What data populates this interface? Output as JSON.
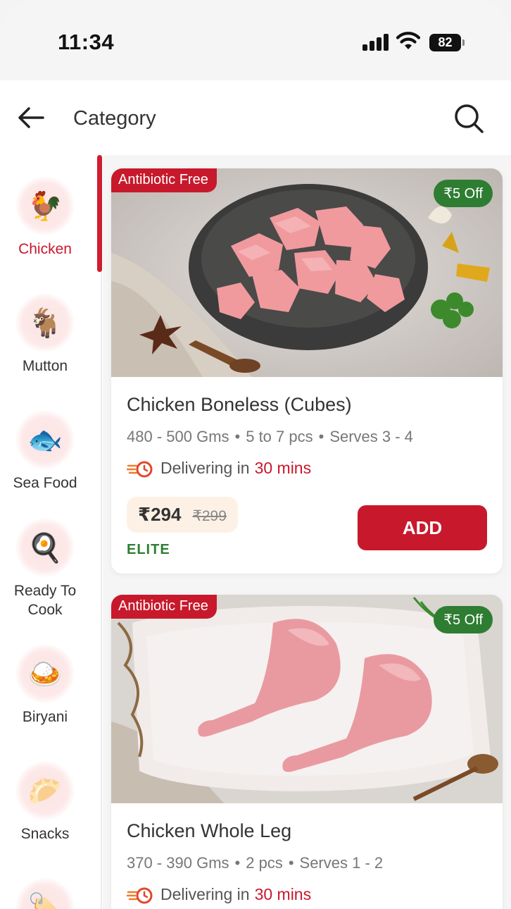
{
  "status_bar": {
    "time": "11:34",
    "battery": "82"
  },
  "header": {
    "title": "Category"
  },
  "categories": [
    {
      "label": "Chicken",
      "icon": "rooster-icon",
      "active": true
    },
    {
      "label": "Mutton",
      "icon": "goat-icon",
      "active": false
    },
    {
      "label": "Sea Food",
      "icon": "fish-icon",
      "active": false
    },
    {
      "label": "Ready To Cook",
      "icon": "pan-icon",
      "active": false
    },
    {
      "label": "Biryani",
      "icon": "biryani-icon",
      "active": false
    },
    {
      "label": "Snacks",
      "icon": "snacks-icon",
      "active": false
    },
    {
      "label": "",
      "icon": "value-combo-icon",
      "active": false
    }
  ],
  "products": [
    {
      "tag": "Antibiotic Free",
      "discount": "₹5 Off",
      "name": "Chicken Boneless (Cubes)",
      "weight": "480 - 500 Gms",
      "pieces": "5 to 7 pcs",
      "serves": "Serves 3 - 4",
      "delivery_prefix": "Delivering in",
      "delivery_time": "30 mins",
      "price": "₹294",
      "mrp": "₹299",
      "membership": "ELITE",
      "add_label": "ADD"
    },
    {
      "tag": "Antibiotic Free",
      "discount": "₹5 Off",
      "name": "Chicken Whole Leg",
      "weight": "370 - 390 Gms",
      "pieces": "2 pcs",
      "serves": "Serves 1 - 2",
      "delivery_prefix": "Delivering in",
      "delivery_time": "30 mins"
    }
  ],
  "colors": {
    "accent": "#c8192c",
    "green": "#2e7d32",
    "price_bg": "#fdf1e6"
  }
}
